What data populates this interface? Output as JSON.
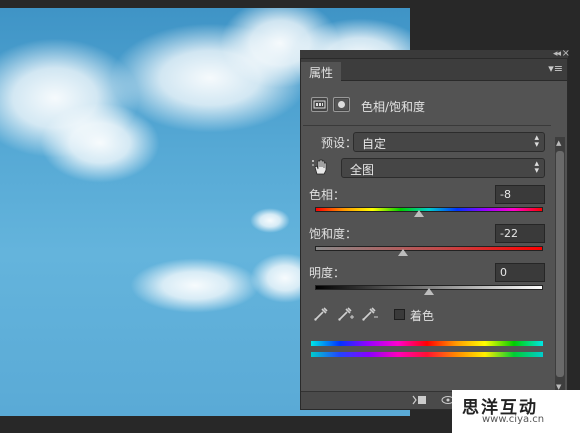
{
  "panel": {
    "tab_label": "属性",
    "collapse_glyph": "◂◂",
    "close_glyph": "×",
    "menu_glyph": "▾≡",
    "header_title": "色相/饱和度"
  },
  "preset": {
    "label": "预设：",
    "value": "自定"
  },
  "channel": {
    "value": "全图"
  },
  "sliders": {
    "hue": {
      "label": "色相：",
      "value": "-8"
    },
    "saturation": {
      "label": "饱和度：",
      "value": "-22"
    },
    "lightness": {
      "label": "明度：",
      "value": "0"
    }
  },
  "colorize": {
    "label": "着色"
  },
  "watermark": {
    "title": "思洋互动",
    "url": "www.ciya.cn"
  }
}
